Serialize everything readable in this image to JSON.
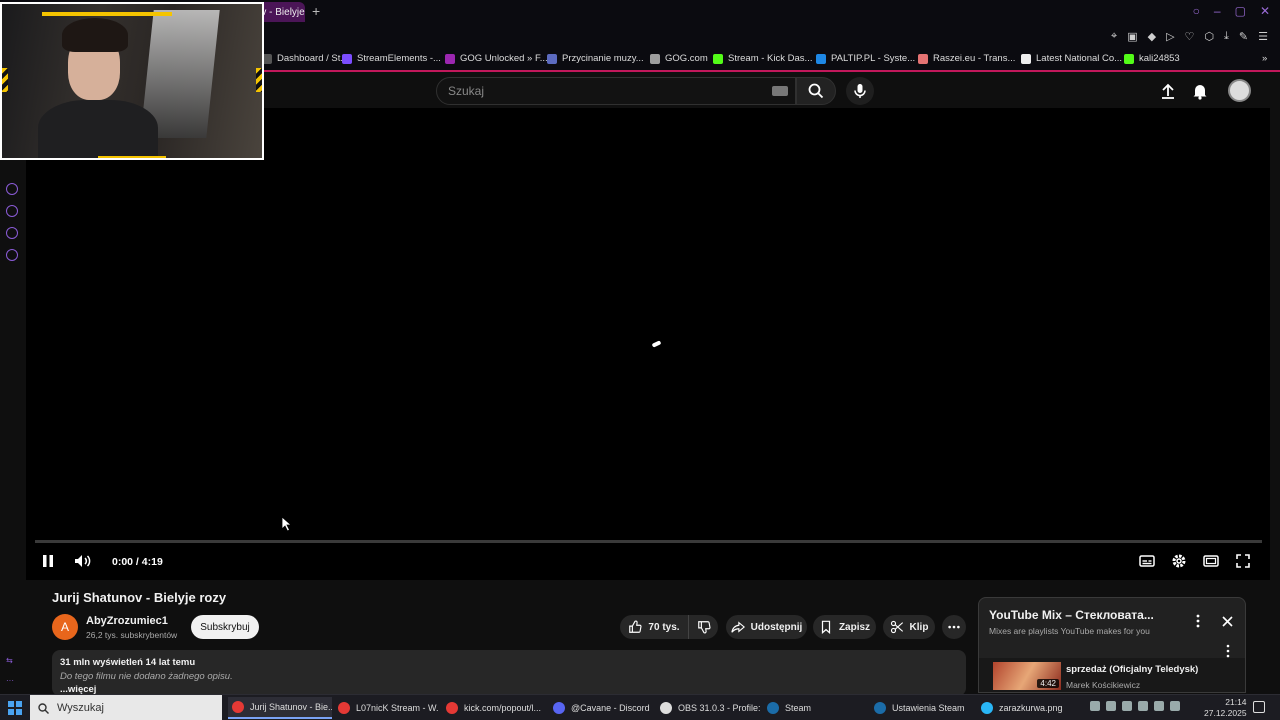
{
  "browser": {
    "active_tab": "Jurij Shatunov - Bielyje rozy",
    "add_tab_glyph": "+",
    "bookmarks": [
      {
        "label": "Dashboard / St...",
        "color": "#555555"
      },
      {
        "label": "StreamElements -...",
        "color": "#7c4dff"
      },
      {
        "label": "GOG Unlocked » F...",
        "color": "#9c27b0"
      },
      {
        "label": "Przycinanie muzy...",
        "color": "#5c6bc0"
      },
      {
        "label": "GOG.com",
        "color": "#9e9e9e"
      },
      {
        "label": "Stream - Kick Das...",
        "color": "#53fc18"
      },
      {
        "label": "PALTIP.PL - Syste...",
        "color": "#1e88e5"
      },
      {
        "label": "Raszei.eu - Trans...",
        "color": "#e57373"
      },
      {
        "label": "Latest National Co...",
        "color": "#eeeeee"
      },
      {
        "label": "kali24853",
        "color": "#53fc18"
      }
    ]
  },
  "youtube": {
    "search_placeholder": "Szukaj",
    "video": {
      "time": "0:00 / 4:19",
      "progress": 0,
      "state": "playing-buffering",
      "title": "Jurij Shatunov - Bielyje rozy"
    },
    "channel": {
      "avatar_letter": "A",
      "name": "AbyZrozumiec1",
      "subs": "26,2 tys. subskrybentów",
      "subscribe_label": "Subskrybuj"
    },
    "actions": {
      "likes": "70 tys.",
      "share": "Udostępnij",
      "save": "Zapisz",
      "clip": "Klip"
    },
    "description": {
      "meta": "31 mln wyświetleń  14 lat temu",
      "text": "Do tego filmu nie dodano żadnego opisu.",
      "more": "...więcej"
    },
    "mix": {
      "title": "YouTube Mix – Стекловата...",
      "subtitle": "Mixes are playlists YouTube makes for you",
      "item_title": "sprzedaż (Oficjalny Teledysk)",
      "item_artist": "Marek Kościkiewicz",
      "item_duration": "4:42"
    }
  },
  "taskbar": {
    "search_placeholder": "Wyszukaj",
    "apps": [
      {
        "label": "Jurij Shatunov - Bie...",
        "color": "#e53935",
        "active": true
      },
      {
        "label": "L07nicK Stream - W...",
        "color": "#e53935",
        "active": false
      },
      {
        "label": "kick.com/popout/l...",
        "color": "#e53935",
        "active": false
      },
      {
        "label": "@Cavane - Discord",
        "color": "#5865f2",
        "active": false
      },
      {
        "label": "OBS 31.0.3 - Profile:...",
        "color": "#dddddd",
        "active": false
      },
      {
        "label": "Steam",
        "color": "#1b6ca8",
        "active": false
      },
      {
        "label": "Ustawienia Steam",
        "color": "#1b6ca8",
        "active": false
      },
      {
        "label": "zarazkurwa.png",
        "color": "#29b6f6",
        "active": false
      }
    ],
    "time": "21:14",
    "date": "27.12.2025"
  }
}
